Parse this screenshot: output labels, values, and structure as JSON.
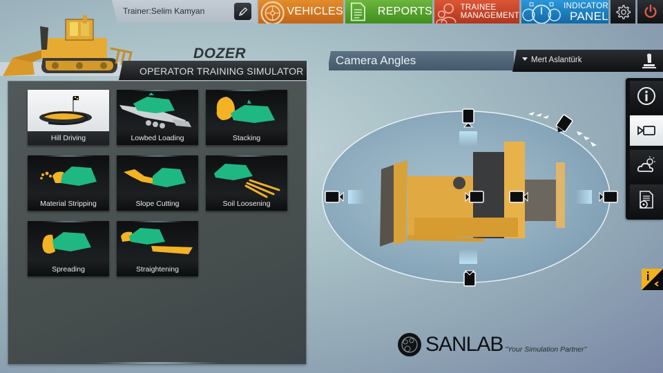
{
  "header": {
    "trainer_label": "Trainer:Selim Kamyan",
    "nav": [
      {
        "id": "vehicles",
        "label": "VEHICLES",
        "color": "#d57a24"
      },
      {
        "id": "reports",
        "label": "REPORTS",
        "color": "#56a22e"
      },
      {
        "id": "trainee",
        "label_line1": "TRAINEE",
        "label_line2": "MANAGEMENT",
        "color": "#c8462a"
      },
      {
        "id": "indicator",
        "label_line1": "INDICATOR",
        "label_line2": "PANEL",
        "color": "#1e80c2"
      }
    ],
    "icons": {
      "edit": "pencil-icon",
      "settings": "gear-icon",
      "power": "power-icon"
    }
  },
  "title": {
    "vehicle": "DOZER",
    "subtitle": "OPERATOR TRAINING SIMULATOR"
  },
  "missions": [
    {
      "label": "Hill Driving",
      "icon": "hill-driving-icon",
      "selected": true
    },
    {
      "label": "Lowbed Loading",
      "icon": "lowbed-loading-icon",
      "selected": false
    },
    {
      "label": "Stacking",
      "icon": "stacking-icon",
      "selected": false
    },
    {
      "label": "Material Stripping",
      "icon": "material-stripping-icon",
      "selected": false
    },
    {
      "label": "Slope Cutting",
      "icon": "slope-cutting-icon",
      "selected": false
    },
    {
      "label": "Soil Loosening",
      "icon": "soil-loosening-icon",
      "selected": false
    },
    {
      "label": "Spreading",
      "icon": "spreading-icon",
      "selected": false
    },
    {
      "label": "Straightening",
      "icon": "straightening-icon",
      "selected": false
    }
  ],
  "camera_panel": {
    "title": "Camera Angles",
    "user": "Mert Aslantürk",
    "cameras": [
      "top",
      "top-right",
      "left",
      "center-left",
      "center-right",
      "right",
      "bottom"
    ]
  },
  "side_toolbar": [
    {
      "id": "info",
      "icon": "info-icon",
      "active": false
    },
    {
      "id": "camera",
      "icon": "camera-icon",
      "active": true
    },
    {
      "id": "weather",
      "icon": "weather-icon",
      "active": false
    },
    {
      "id": "report",
      "icon": "report-icon",
      "active": false
    }
  ],
  "brand": {
    "name": "SANLAB",
    "tagline": "\"Your Simulation Partner\""
  },
  "colors": {
    "accent_yellow": "#f1b21c",
    "mission_green": "#1fb882",
    "mission_yellow": "#f3b324"
  }
}
